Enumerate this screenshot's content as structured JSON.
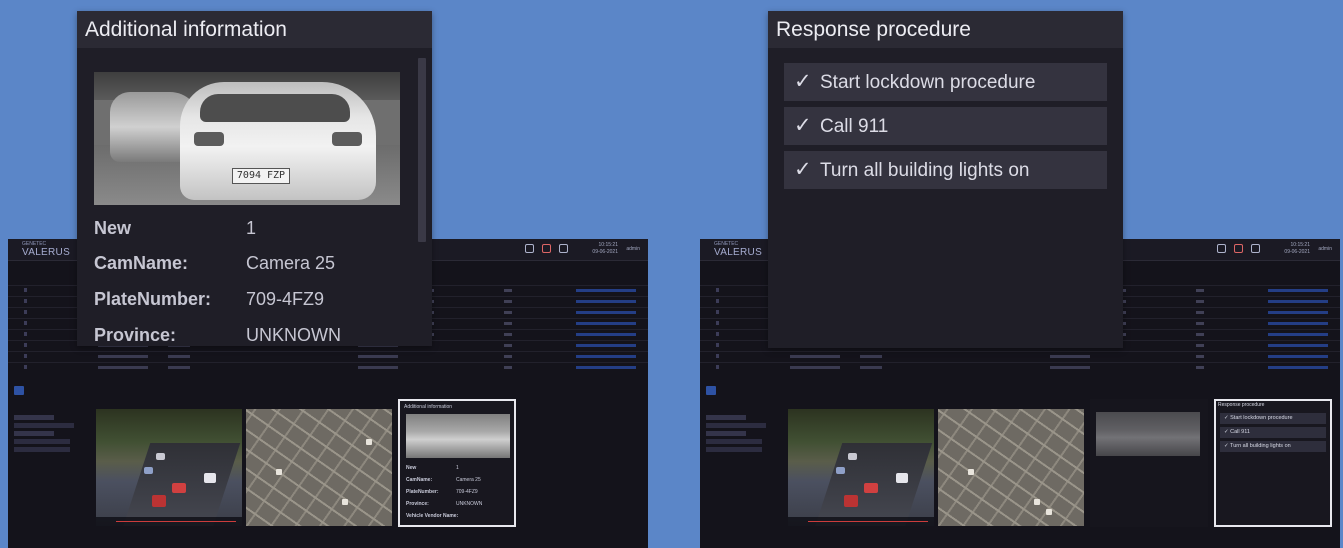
{
  "app": {
    "brand_small": "GENETEC",
    "brand": "VALERUS",
    "time": "10:15:21",
    "date": "09-06-2021",
    "user": "admin"
  },
  "left_app": {
    "mini_info_panel": {
      "title": "Additional information",
      "rows": [
        {
          "label": "New",
          "value": "1"
        },
        {
          "label": "CamName:",
          "value": "Camera 25"
        },
        {
          "label": "PlateNumber:",
          "value": "709-4FZ9"
        },
        {
          "label": "Province:",
          "value": "UNKNOWN"
        },
        {
          "label": "Vehicle Vendor Name:",
          "value": ""
        }
      ]
    }
  },
  "right_app": {
    "mini_resp_panel": {
      "title": "Response procedure",
      "items": [
        "Start lockdown procedure",
        "Call 911",
        "Turn all building lights on"
      ]
    }
  },
  "info_popup": {
    "title": "Additional information",
    "plate_text": "7094 FZP",
    "fields": [
      {
        "label": "New",
        "value": "1"
      },
      {
        "label": "CamName:",
        "value": "Camera 25"
      },
      {
        "label": "PlateNumber:",
        "value": "709-4FZ9"
      },
      {
        "label": "Province:",
        "value": "UNKNOWN"
      }
    ]
  },
  "resp_popup": {
    "title": "Response procedure",
    "check_glyph": "✓",
    "items": [
      {
        "label": "Start lockdown procedure"
      },
      {
        "label": "Call 911"
      },
      {
        "label": "Turn all building lights on"
      }
    ]
  },
  "colors": {
    "background": "#5b86c8",
    "panel": "#1f1e27",
    "panel_header": "#2b2a34",
    "item_bg": "#34333f",
    "link_blue": "#243e86"
  }
}
